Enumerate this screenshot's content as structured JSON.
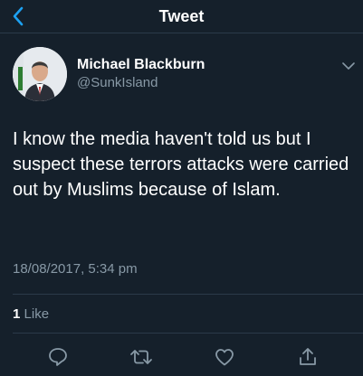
{
  "navbar": {
    "title": "Tweet",
    "back_icon": "chevron-left-icon"
  },
  "tweet": {
    "author_name": "Michael Blackburn",
    "author_handle": "@SunkIsland",
    "text": "I know the media haven't told us but I suspect these terrors attacks were carried out by Muslims because of Islam.",
    "timestamp": "18/08/2017, 5:34 pm",
    "likes_count": "1",
    "likes_label": "Like"
  },
  "actions": [
    "reply-icon",
    "retweet-icon",
    "like-icon",
    "share-icon"
  ],
  "colors": {
    "background": "#15202b",
    "accent": "#1da1f2",
    "text": "#ffffff",
    "secondary_text": "#8899a6",
    "divider": "#2b3a49"
  }
}
